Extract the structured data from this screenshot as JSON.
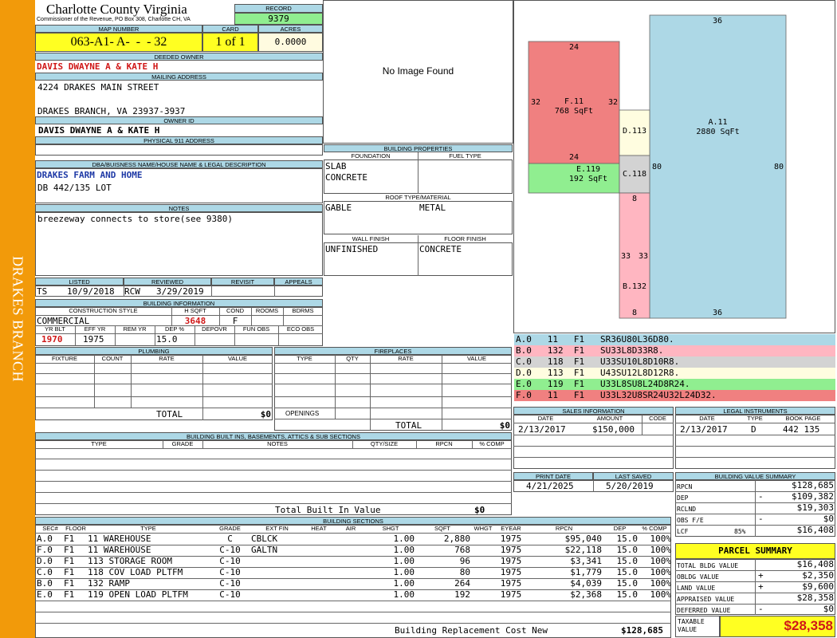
{
  "sidebar": {
    "text": "DRAKES BRANCH",
    "color": "#f29a0a"
  },
  "header": {
    "county": "Charlotte County Virginia",
    "commissioner": "Commissioner of the Revenue, PO Box 308, Charlotte CH, VA",
    "record_label": "RECORD",
    "record_value": "9379"
  },
  "parcel_id": {
    "map_label": "MAP NUMBER",
    "map_value": "063-A1- A-  -  - 32",
    "card_label": "CARD",
    "card_value": "1 of 1",
    "acres_label": "ACRES",
    "acres_value": "0.0000"
  },
  "owner": {
    "deeded_label": "DEEDED OWNER",
    "deeded_value": "DAVIS DWAYNE A & KATE H",
    "mailing_label": "MAILING ADDRESS",
    "address1": "4224 DRAKES MAIN STREET",
    "address2": "DRAKES BRANCH, VA 23937-3937",
    "owner_id_label": "OWNER ID",
    "owner_id_value": "DAVIS DWAYNE A & KATE H",
    "physical_label": "PHYSICAL 911 ADDRESS"
  },
  "legal": {
    "label": "DBA/BUISNESS NAME/HOUSE NAME & LEGAL DESCRIPTION",
    "name": "DRAKES FARM AND HOME",
    "desc": "DB 442/135 LOT"
  },
  "notes": {
    "label": "NOTES",
    "text": "breezeway connects to store(see 9380)"
  },
  "image": {
    "text": "No Image Found"
  },
  "building_properties": {
    "label": "BUILDING PROPERTIES",
    "foundation_label": "FOUNDATION",
    "fuel_label": "FUEL TYPE",
    "foundation1": "SLAB",
    "foundation2": "CONCRETE",
    "roof_label": "ROOF TYPE/MATERIAL",
    "roof_type": "GABLE",
    "roof_material": "METAL",
    "wall_label": "WALL FINISH",
    "floor_label": "FLOOR FINISH",
    "wall_value": "UNFINISHED",
    "floor_value": "CONCRETE"
  },
  "listing": {
    "listed_label": "LISTED",
    "reviewed_label": "REVIEWED",
    "revisit_label": "REVISIT",
    "appeals_label": "APPEALS",
    "listed_by": "TS",
    "listed_date": "10/9/2018",
    "reviewed_by": "RCW",
    "reviewed_date": "3/29/2019"
  },
  "building_info": {
    "label": "BUILDING INFORMATION",
    "style_label": "CONSTRUCTION STYLE",
    "hsqft_label": "H SQFT",
    "cond_label": "COND",
    "rooms_label": "ROOMS",
    "bdrms_label": "BDRMS",
    "style": "COMMERCIAL",
    "hsqft": "3648",
    "cond": "F",
    "yrblt_label": "YR BLT",
    "effyr_label": "EFF YR",
    "remyr_label": "REM YR",
    "dep_label": "DEP %",
    "depovr_label": "DEPOVR",
    "funobs_label": "FUN OBS",
    "ecoobs_label": "ECO OBS",
    "yrblt": "1970",
    "effyr": "1975",
    "dep": "15.0"
  },
  "plumbing": {
    "label": "PLUMBING",
    "cols": [
      "FIXTURE",
      "COUNT",
      "RATE",
      "VALUE"
    ],
    "total_label": "TOTAL",
    "total": "$0"
  },
  "fireplaces": {
    "label": "FIREPLACES",
    "cols": [
      "TYPE",
      "QTY",
      "RATE",
      "VALUE"
    ],
    "openings_label": "OPENINGS",
    "total_label": "TOTAL",
    "total": "$0"
  },
  "builtins": {
    "label": "BUILDING BUILT INS, BASEMENTS, ATTICS & SUB SECTIONS",
    "cols": [
      "TYPE",
      "GRADE",
      "NOTES",
      "QTY/SIZE",
      "RPCN",
      "% COMP"
    ],
    "total_label": "Total Built In Value",
    "total": "$0"
  },
  "sketch": {
    "areas": [
      {
        "code": "A.11",
        "sqft": "2880 SqFt",
        "color": "#add8e6"
      },
      {
        "code": "F.11",
        "sqft": "768 SqFt",
        "color": "#f08080"
      },
      {
        "code": "E.119",
        "sqft": "192 SqFt",
        "color": "#90ee90"
      },
      {
        "code": "D.113",
        "color": "#fffde0"
      },
      {
        "code": "C.118",
        "color": "#d3d3d3"
      },
      {
        "code": "B.132",
        "color": "#ffb6c1"
      }
    ],
    "dims": [
      "36",
      "36",
      "80",
      "80",
      "24",
      "24",
      "32",
      "32",
      "8",
      "33",
      "33",
      "8"
    ]
  },
  "sections_legend": [
    {
      "text": "A.0   11   F1   SR36U80L36D80.",
      "color": "#add8e6"
    },
    {
      "text": "B.0   132  F1   SU33L8D33R8.",
      "color": "#ffb6c1"
    },
    {
      "text": "C.0   118  F1   U33SU10L8D10R8.",
      "color": "#d3d3d3"
    },
    {
      "text": "D.0   113  F1   U43SU12L8D12R8.",
      "color": "#fffde0"
    },
    {
      "text": "E.0   119  F1   U33L8SU8L24D8R24.",
      "color": "#90ee90"
    },
    {
      "text": "F.0   11   F1   U33L32U8SR24U32L24D32.",
      "color": "#f08080"
    }
  ],
  "sales": {
    "label": "SALES INFORMATION",
    "cols": [
      "DATE",
      "AMOUNT",
      "CODE"
    ],
    "date": "2/13/2017",
    "amount": "$150,000"
  },
  "legal_instruments": {
    "label": "LEGAL INSTRUMENTS",
    "cols": [
      "DATE",
      "TYPE",
      "BOOK PAGE"
    ],
    "date": "2/13/2017",
    "type": "D",
    "bookpage": "442 135"
  },
  "dates": {
    "print_label": "PRINT DATE",
    "saved_label": "LAST SAVED",
    "print": "4/21/2025",
    "saved": "5/20/2019"
  },
  "value_summary": {
    "label": "BUILDING VALUE SUMMARY",
    "rows": [
      {
        "label": "RPCN",
        "sign": "",
        "value": "$128,685"
      },
      {
        "label": "DEP",
        "sign": "-",
        "value": "$109,382"
      },
      {
        "label": "RCLND",
        "sign": "",
        "value": "$19,303"
      },
      {
        "label": "OBS F/E",
        "sign": "-",
        "value": "$0"
      },
      {
        "label": "LCF",
        "pct": "85%",
        "sign": "",
        "value": "$16,408"
      }
    ]
  },
  "parcel_summary": {
    "label": "PARCEL SUMMARY",
    "rows": [
      {
        "label": "TOTAL BLDG VALUE",
        "sign": "",
        "value": "$16,408"
      },
      {
        "label": "OBLDG VALUE",
        "sign": "+",
        "value": "$2,350"
      },
      {
        "label": "LAND VALUE",
        "sign": "+",
        "value": "$9,600"
      },
      {
        "label": "APPRAISED VALUE",
        "sign": "",
        "value": "$28,358"
      },
      {
        "label": "DEFERRED VALUE",
        "sign": "-",
        "value": "$0"
      }
    ],
    "taxable_label": "TAXABLE VALUE",
    "taxable": "$28,358"
  },
  "building_sections": {
    "label": "BUILDING SECTIONS",
    "cols": [
      "SEC#",
      "FLOOR",
      "TYPE",
      "GRADE",
      "EXT FIN",
      "HEAT",
      "AIR",
      "SHGT",
      "SQFT",
      "WHGT",
      "EYEAR",
      "RPCN",
      "DEP",
      "% COMP"
    ],
    "rows": [
      [
        "A.0",
        "F1",
        "11 WAREHOUSE",
        "C",
        "CBLCK",
        "",
        "",
        "1.00",
        "2,880",
        "",
        "1975",
        "$95,040",
        "15.0",
        "100%"
      ],
      [
        "F.0",
        "F1",
        "11 WAREHOUSE",
        "C-10",
        "GALTN",
        "",
        "",
        "1.00",
        "768",
        "",
        "1975",
        "$22,118",
        "15.0",
        "100%"
      ],
      [
        "D.0",
        "F1",
        "113 STORAGE ROOM",
        "C-10",
        "",
        "",
        "",
        "1.00",
        "96",
        "",
        "1975",
        "$3,341",
        "15.0",
        "100%"
      ],
      [
        "C.0",
        "F1",
        "118 COV LOAD PLTFM",
        "C-10",
        "",
        "",
        "",
        "1.00",
        "80",
        "",
        "1975",
        "$1,779",
        "15.0",
        "100%"
      ],
      [
        "B.0",
        "F1",
        "132 RAMP",
        "C-10",
        "",
        "",
        "",
        "1.00",
        "264",
        "",
        "1975",
        "$4,039",
        "15.0",
        "100%"
      ],
      [
        "E.0",
        "F1",
        "119 OPEN LOAD PLTFM",
        "C-10",
        "",
        "",
        "",
        "1.00",
        "192",
        "",
        "1975",
        "$2,368",
        "15.0",
        "100%"
      ]
    ],
    "total_label": "Building Replacement Cost New",
    "total": "$128,685"
  }
}
